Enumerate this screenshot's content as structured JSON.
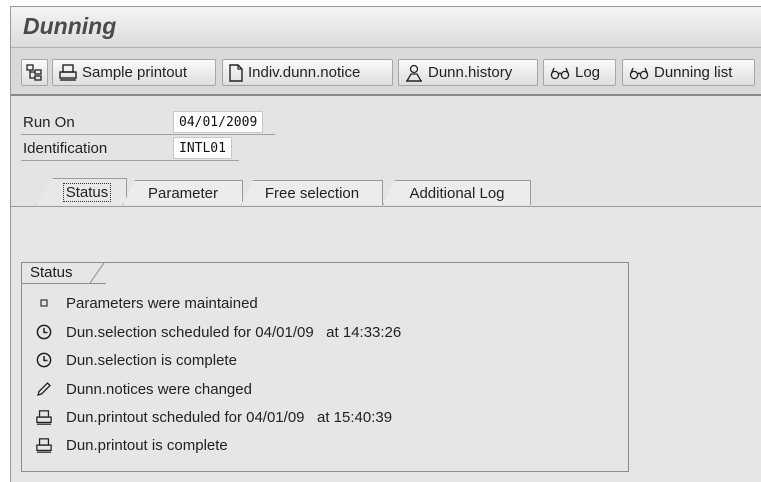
{
  "window": {
    "title": "Dunning"
  },
  "toolbar": {
    "buttons": [
      {
        "label": "",
        "icon": "tree-structure-icon"
      },
      {
        "label": "Sample printout",
        "icon": "printer-icon"
      },
      {
        "label": "Indiv.dunn.notice",
        "icon": "document-icon"
      },
      {
        "label": "Dunn.history",
        "icon": "person-icon"
      },
      {
        "label": "Log",
        "icon": "glasses-icon"
      },
      {
        "label": "Dunning list",
        "icon": "glasses-icon"
      }
    ]
  },
  "header": {
    "run_on": {
      "label": "Run On",
      "value": "04/01/2009"
    },
    "identification": {
      "label": "Identification",
      "value": "INTL01"
    }
  },
  "tabs": [
    {
      "label": "Status",
      "active": true
    },
    {
      "label": "Parameter",
      "active": false
    },
    {
      "label": "Free selection",
      "active": false
    },
    {
      "label": "Additional Log",
      "active": false
    }
  ],
  "status_box": {
    "title": "Status",
    "items": [
      {
        "icon": "small-square-icon",
        "text": "Parameters were maintained"
      },
      {
        "icon": "clock-icon",
        "text": "Dun.selection scheduled for 04/01/09   at 14:33:26"
      },
      {
        "icon": "clock-icon",
        "text": "Dun.selection is complete"
      },
      {
        "icon": "pencil-icon",
        "text": "Dunn.notices were changed"
      },
      {
        "icon": "printer-icon",
        "text": "Dun.printout scheduled for 04/01/09   at 15:40:39"
      },
      {
        "icon": "printer-icon",
        "text": "Dun.printout is complete"
      }
    ]
  }
}
